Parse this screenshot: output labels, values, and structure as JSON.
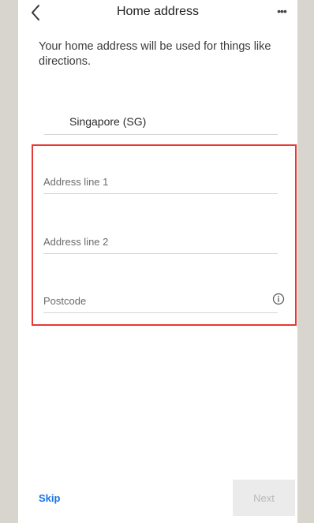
{
  "header": {
    "title": "Home address",
    "back_icon": "chevron-left-icon",
    "more_label": "•••"
  },
  "description": "Your home address will be used for things like directions.",
  "country": {
    "value": "Singapore (SG)"
  },
  "fields": {
    "address_line_1": {
      "placeholder": "Address line 1",
      "value": ""
    },
    "address_line_2": {
      "placeholder": "Address line 2",
      "value": ""
    },
    "postcode": {
      "placeholder": "Postcode",
      "value": "",
      "info_icon": "info-icon"
    }
  },
  "footer": {
    "skip_label": "Skip",
    "next_label": "Next"
  },
  "colors": {
    "highlight": "#e53935",
    "link": "#1a73e8",
    "next_disabled_bg": "#ebebeb",
    "next_disabled_text": "#b9b9b9"
  }
}
